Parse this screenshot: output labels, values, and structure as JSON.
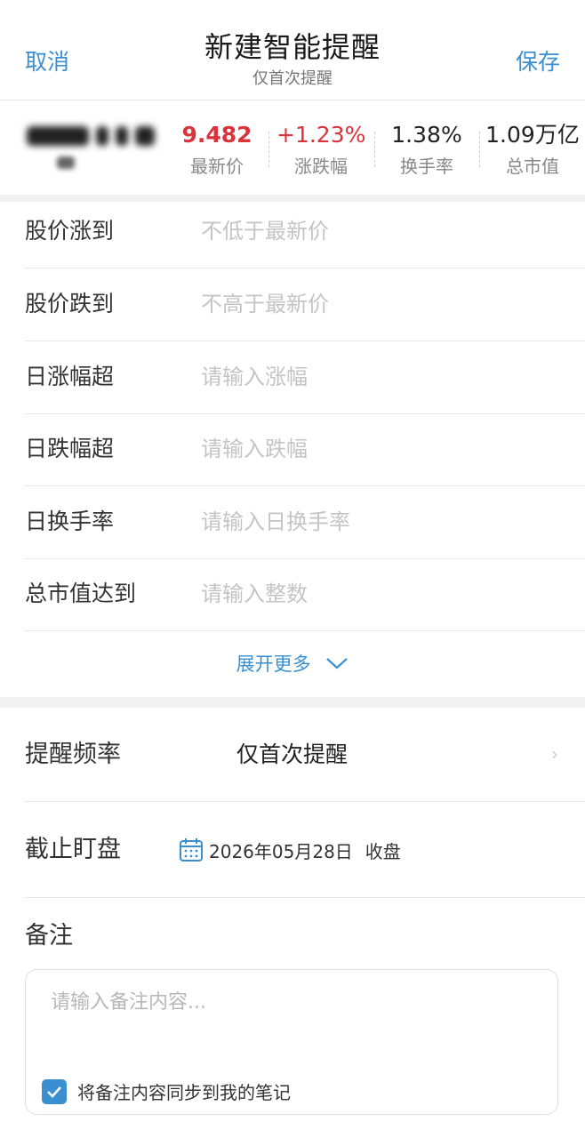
{
  "header": {
    "cancel_label": "取消",
    "save_label": "保存",
    "title": "新建智能提醒",
    "subtitle": "仅首次提醒"
  },
  "quote": {
    "metrics": [
      {
        "value": "9.482",
        "label": "最新价",
        "color": "#d9343b"
      },
      {
        "value": "+1.23%",
        "label": "涨跌幅",
        "color": "#d9343b"
      },
      {
        "value": "1.38%",
        "label": "换手率",
        "color": "#222222"
      },
      {
        "value": "1.09万亿",
        "label": "总市值",
        "color": "#222222"
      }
    ]
  },
  "conditions": [
    {
      "label": "股价涨到",
      "placeholder": "不低于最新价"
    },
    {
      "label": "股价跌到",
      "placeholder": "不高于最新价"
    },
    {
      "label": "日涨幅超",
      "placeholder": "请输入涨幅"
    },
    {
      "label": "日跌幅超",
      "placeholder": "请输入跌幅"
    },
    {
      "label": "日换手率",
      "placeholder": "请输入日换手率"
    },
    {
      "label": "总市值达到",
      "placeholder": "请输入整数"
    }
  ],
  "expand_label": "展开更多",
  "frequency": {
    "label": "提醒频率",
    "value": "仅首次提醒"
  },
  "deadline": {
    "label": "截止盯盘",
    "date": "2026年05月28日",
    "time": "收盘"
  },
  "notes": {
    "label": "备注",
    "placeholder": "请输入备注内容...",
    "sync_label": "将备注内容同步到我的笔记",
    "sync_checked": true
  },
  "colors": {
    "accent": "#3a8fd0",
    "up": "#d9343b"
  }
}
